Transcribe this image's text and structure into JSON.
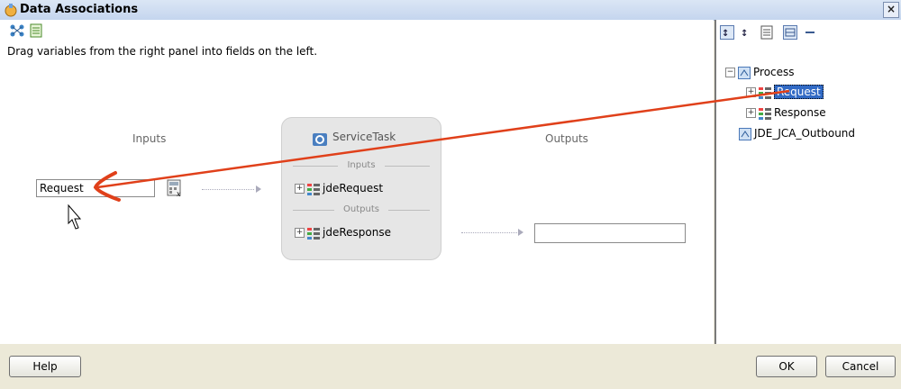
{
  "window": {
    "title": "Data Associations",
    "close_label": "×"
  },
  "instruction": "Drag variables from the right panel into fields on the left.",
  "columns": {
    "inputs": "Inputs",
    "outputs": "Outputs"
  },
  "fields": {
    "input_value": "Request",
    "output_value": ""
  },
  "task": {
    "title": "ServiceTask",
    "inputs_label": "Inputs",
    "outputs_label": "Outputs",
    "input_param": "jdeRequest",
    "output_param": "jdeResponse"
  },
  "tree": {
    "root": "Process",
    "children": [
      "Request",
      "Response"
    ],
    "sibling": "JDE_JCA_Outbound",
    "selected": "Request"
  },
  "buttons": {
    "help": "Help",
    "ok": "OK",
    "cancel": "Cancel"
  },
  "colors": {
    "annotation_arrow": "#e0401a",
    "selection": "#316ac5"
  },
  "icons": [
    "process-icon",
    "expression-builder-icon",
    "gear-icon",
    "variable-icon",
    "sort-ascending-icon",
    "sort-descending-icon"
  ]
}
